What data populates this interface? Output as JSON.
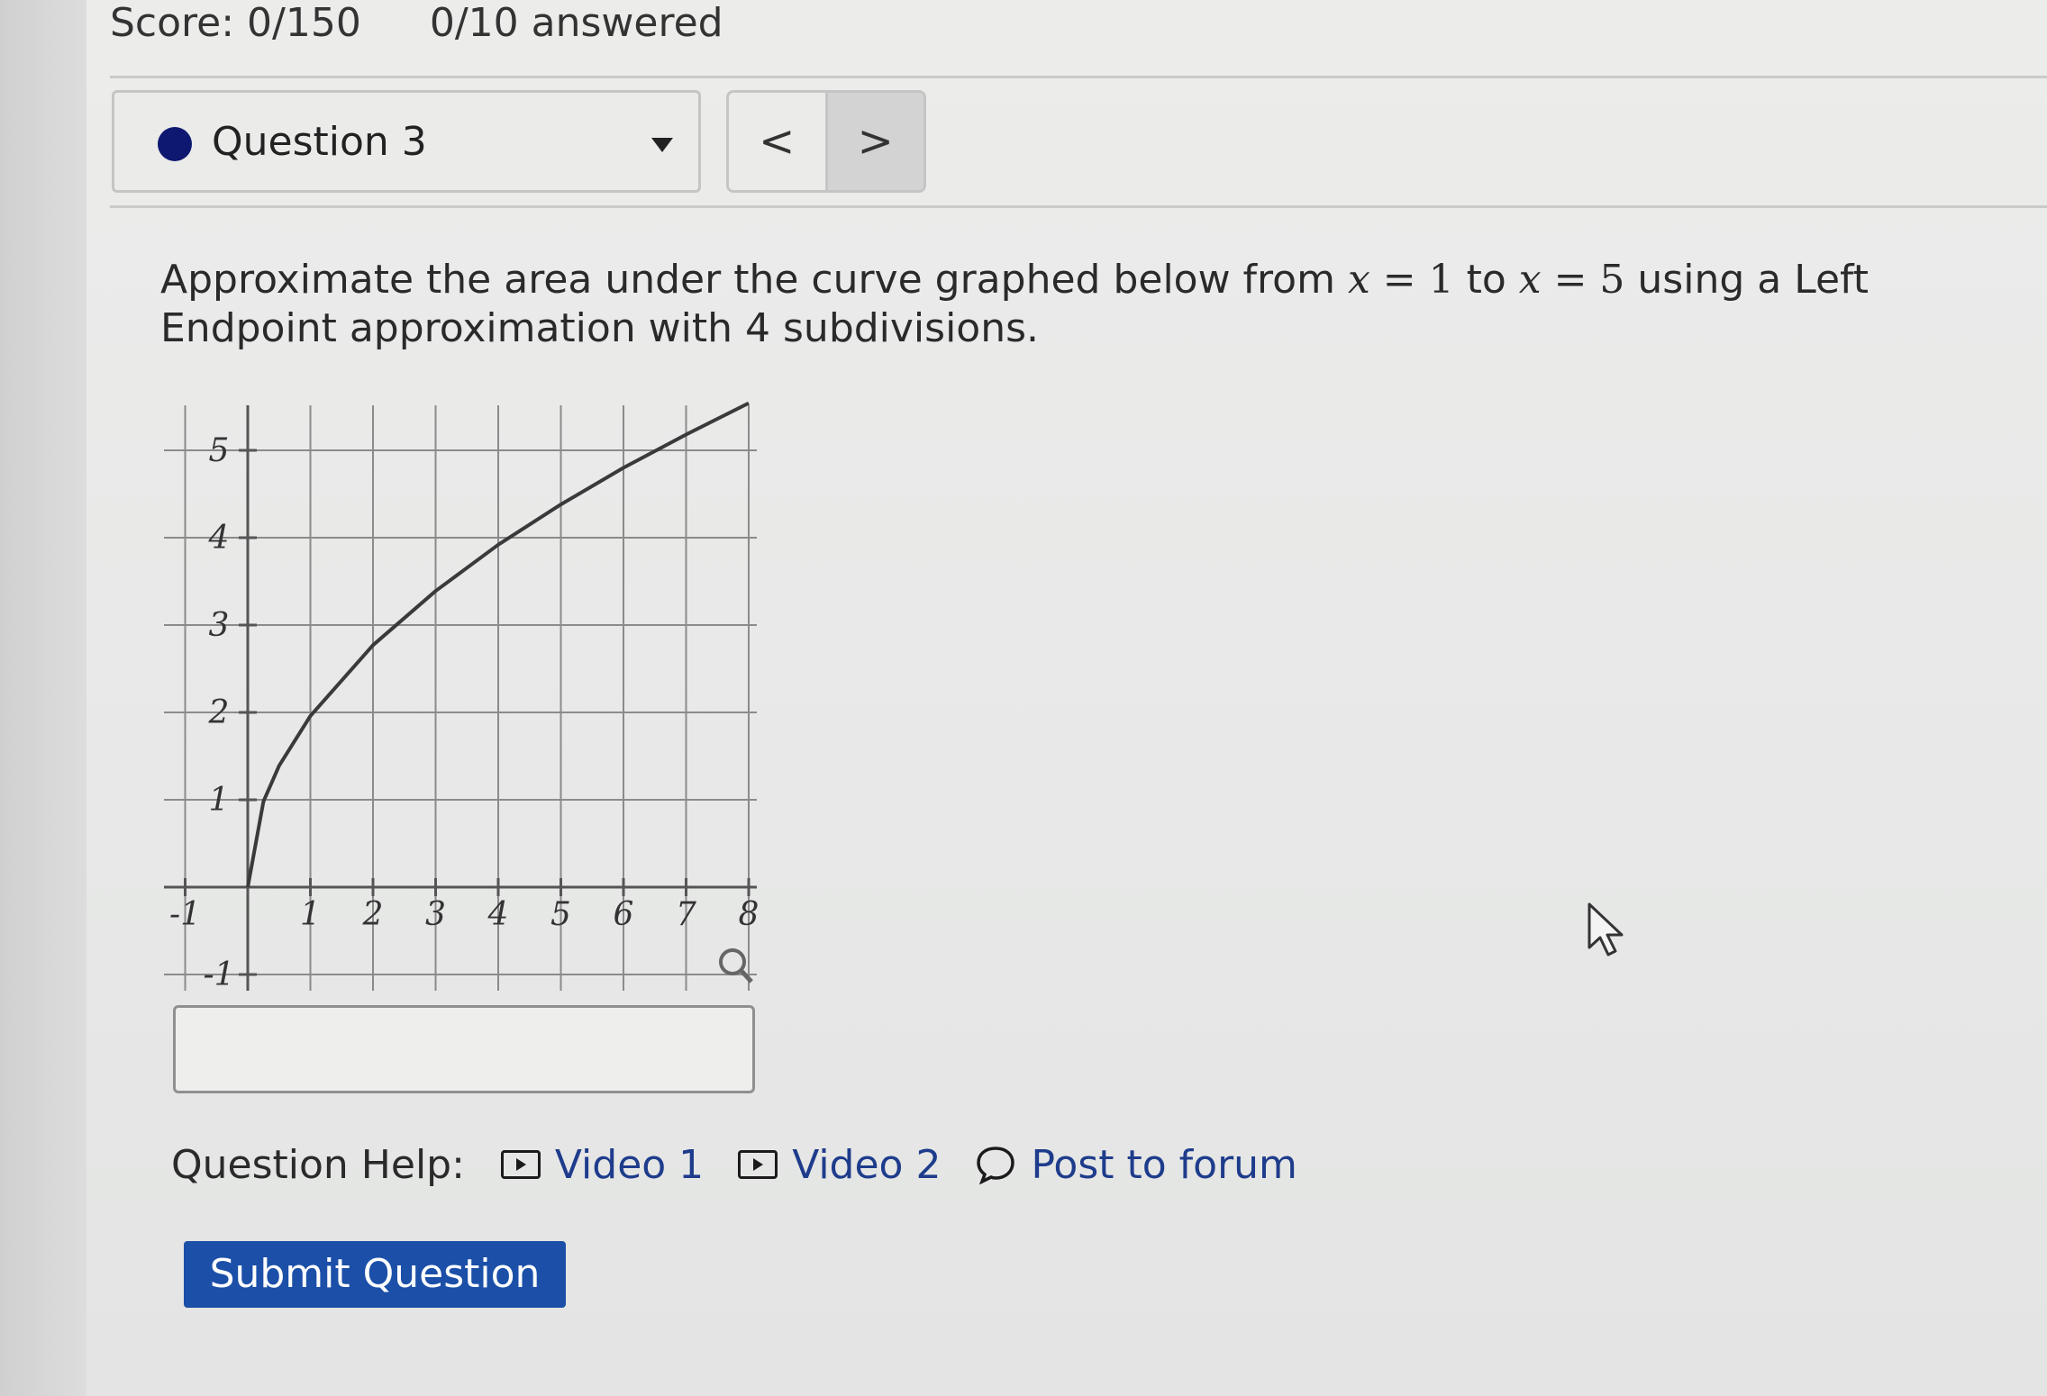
{
  "header": {
    "score": "Score: 0/150",
    "answered": "0/10 answered"
  },
  "question_selector": {
    "label": "Question 3",
    "prev_glyph": "<",
    "next_glyph": ">"
  },
  "question": {
    "part1": "Approximate the area under the curve graphed below from ",
    "var1": "x",
    "eq1": " = 1",
    "part2": " to ",
    "var2": "x",
    "eq2": " = 5",
    "part3": " using a Left Endpoint approximation with 4 subdivisions."
  },
  "chart_data": {
    "type": "line",
    "title": "",
    "xlabel": "",
    "ylabel": "",
    "xlim": [
      -1,
      8.2
    ],
    "ylim": [
      -1,
      5.5
    ],
    "x_ticks": [
      "-1",
      "1",
      "2",
      "3",
      "4",
      "5",
      "6",
      "7",
      "8"
    ],
    "y_ticks": [
      "-1",
      "1",
      "2",
      "3",
      "4",
      "5"
    ],
    "grid": true,
    "series": [
      {
        "x": [
          0,
          0.25,
          0.5,
          1,
          2,
          3,
          4,
          5,
          6,
          7,
          8
        ],
        "y": [
          0,
          0.98,
          1.39,
          1.96,
          2.77,
          3.39,
          3.92,
          4.38,
          4.8,
          5.18,
          5.54
        ]
      }
    ]
  },
  "answer": {
    "value": ""
  },
  "help": {
    "label": "Question Help:",
    "video1": "Video 1",
    "video2": "Video 2",
    "forum": "Post to forum"
  },
  "submit": {
    "label": "Submit Question"
  },
  "icons": {
    "video": "video-play-icon",
    "forum": "speech-bubble-icon",
    "zoom": "magnifier-icon",
    "cursor": "mouse-pointer-icon"
  }
}
